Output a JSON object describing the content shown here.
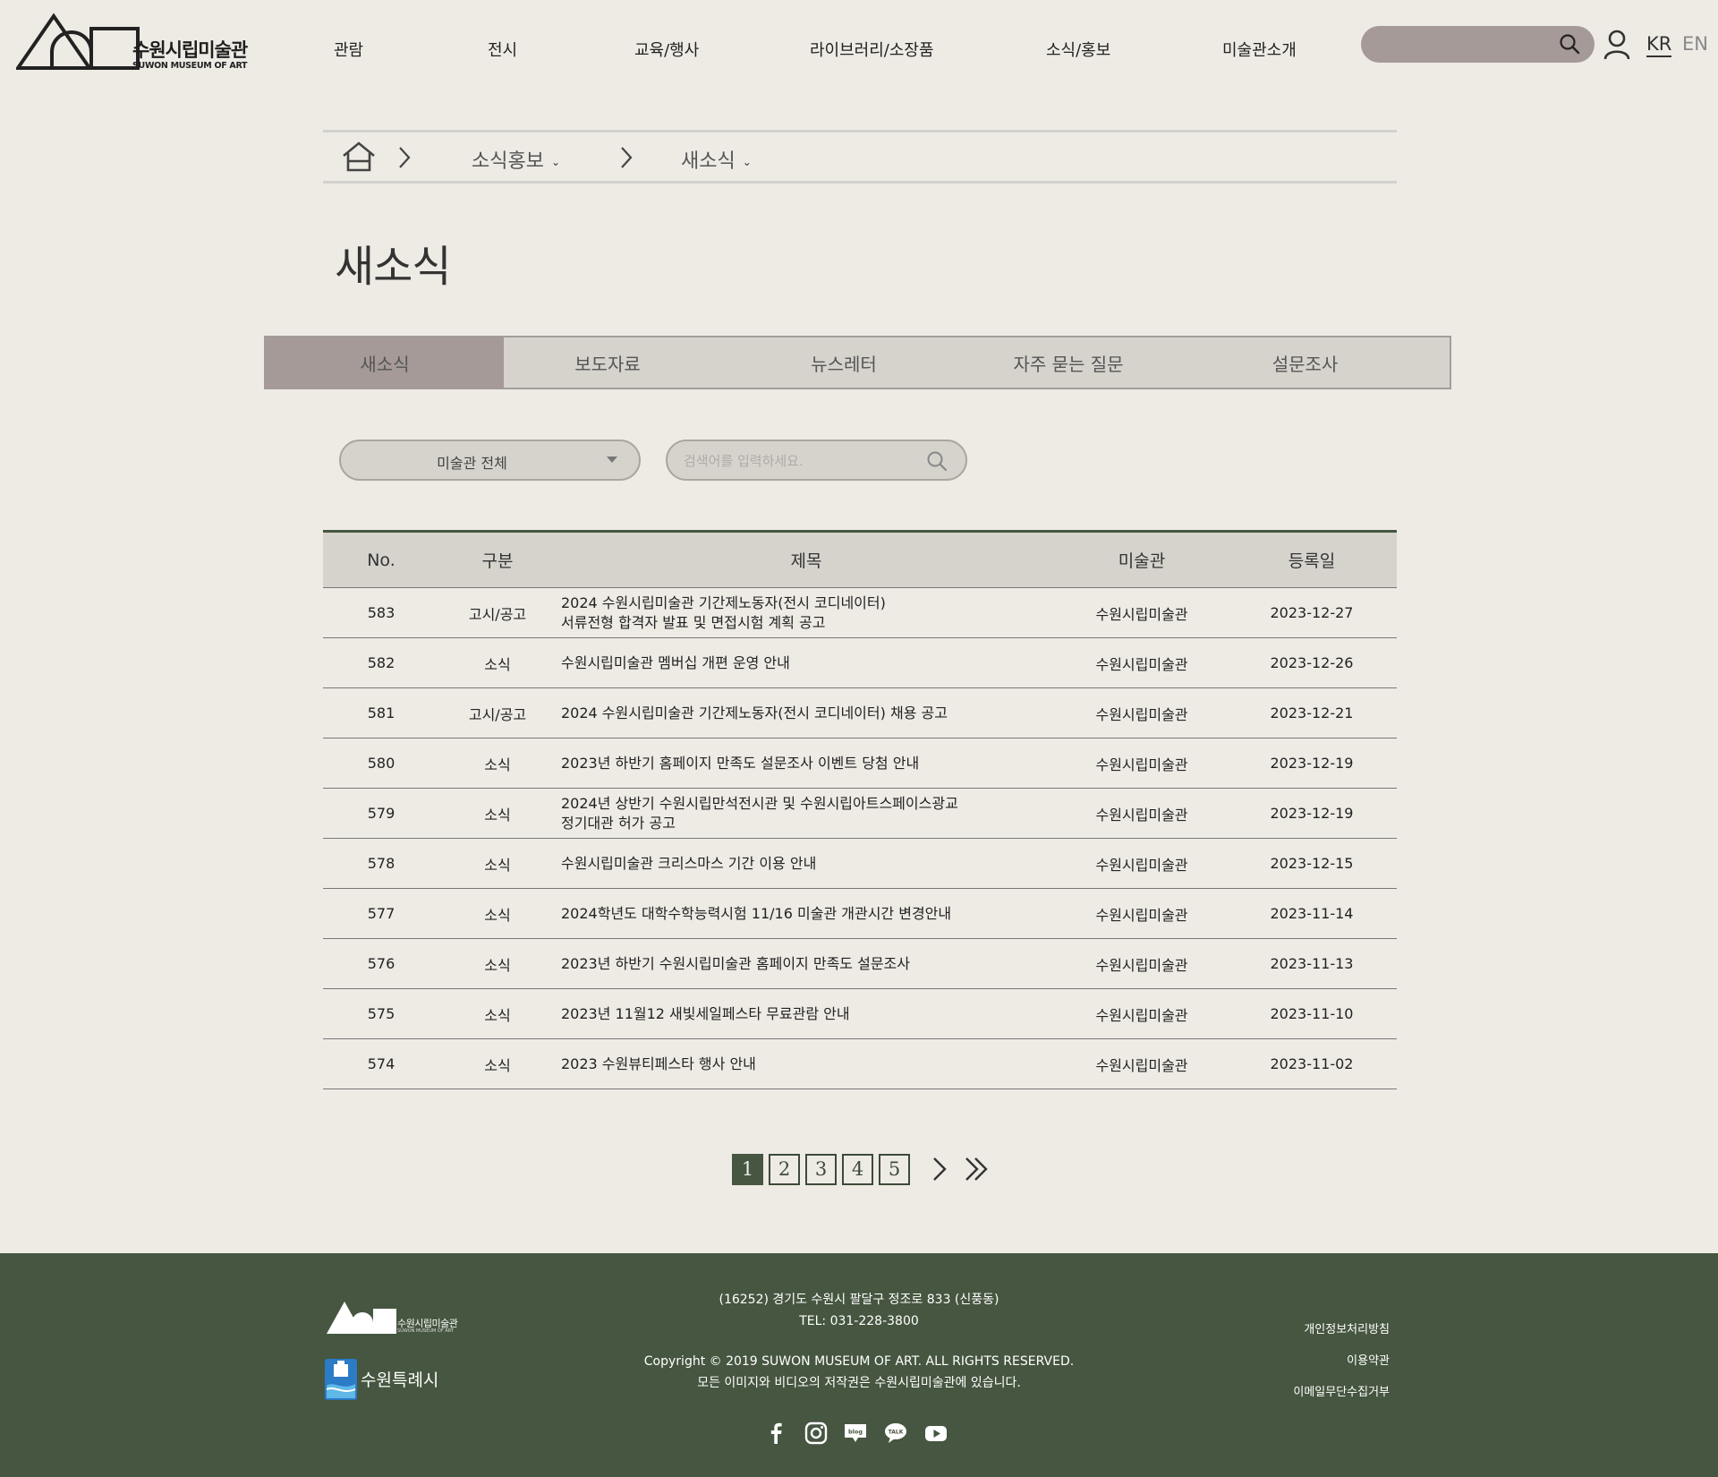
{
  "header": {
    "logo_text": "수원시립미술관",
    "logo_sub": "SUWON MUSEUM OF ART",
    "nav": [
      "관람",
      "전시",
      "교육/행사",
      "라이브러리/소장품",
      "소식/홍보",
      "미술관소개"
    ],
    "lang_kr": "KR",
    "lang_en": "EN"
  },
  "breadcrumb": {
    "section": "소식홍보",
    "page": "새소식"
  },
  "page_title": "새소식",
  "tabs": [
    {
      "label": "새소식",
      "active": true
    },
    {
      "label": "보도자료",
      "active": false
    },
    {
      "label": "뉴스레터",
      "active": false
    },
    {
      "label": "자주 묻는 질문",
      "active": false
    },
    {
      "label": "설문조사",
      "active": false
    }
  ],
  "filter": {
    "select_value": "미술관 전체",
    "search_placeholder": "검색어를 입력하세요."
  },
  "table": {
    "headers": [
      "No.",
      "구분",
      "제목",
      "미술관",
      "등록일"
    ],
    "rows": [
      {
        "no": "583",
        "category": "고시/공고",
        "title": "2024 수원시립미술관 기간제노동자(전시 코디네이터)\n서류전형 합격자 발표 및 면접시험 계획 공고",
        "museum": "수원시립미술관",
        "date": "2023-12-27"
      },
      {
        "no": "582",
        "category": "소식",
        "title": "수원시립미술관 멤버십 개편 운영 안내",
        "museum": "수원시립미술관",
        "date": "2023-12-26"
      },
      {
        "no": "581",
        "category": "고시/공고",
        "title": "2024 수원시립미술관 기간제노동자(전시 코디네이터) 채용 공고",
        "museum": "수원시립미술관",
        "date": "2023-12-21"
      },
      {
        "no": "580",
        "category": "소식",
        "title": "2023년 하반기 홈페이지 만족도 설문조사 이벤트 당첨 안내",
        "museum": "수원시립미술관",
        "date": "2023-12-19"
      },
      {
        "no": "579",
        "category": "소식",
        "title": "2024년 상반기 수원시립만석전시관 및 수원시립아트스페이스광교\n정기대관 허가 공고",
        "museum": "수원시립미술관",
        "date": "2023-12-19"
      },
      {
        "no": "578",
        "category": "소식",
        "title": "수원시립미술관 크리스마스 기간 이용 안내",
        "museum": "수원시립미술관",
        "date": "2023-12-15"
      },
      {
        "no": "577",
        "category": "소식",
        "title": "2024학년도 대학수학능력시험 11/16 미술관 개관시간 변경안내",
        "museum": "수원시립미술관",
        "date": "2023-11-14"
      },
      {
        "no": "576",
        "category": "소식",
        "title": "2023년 하반기 수원시립미술관 홈페이지 만족도 설문조사",
        "museum": "수원시립미술관",
        "date": "2023-11-13"
      },
      {
        "no": "575",
        "category": "소식",
        "title": "2023년 11월12 새빛세일페스타 무료관람 안내",
        "museum": "수원시립미술관",
        "date": "2023-11-10"
      },
      {
        "no": "574",
        "category": "소식",
        "title": "2023 수원뷰티페스타 행사 안내",
        "museum": "수원시립미술관",
        "date": "2023-11-02"
      }
    ]
  },
  "pagination": {
    "pages": [
      "1",
      "2",
      "3",
      "4",
      "5"
    ],
    "current": "1"
  },
  "footer": {
    "logo_text": "수원시립미술관",
    "logo_sub": "SUWON MUSEUM OF ART",
    "city_text": "수원특례시",
    "address": "(16252) 경기도 수원시 팔달구 정조로 833 (신풍동)",
    "tel": "TEL: 031-228-3800",
    "copyright": "Copyright © 2019 SUWON MUSEUM OF ART. ALL RIGHTS RESERVED.",
    "rights": "모든 이미지와 비디오의 저작권은 수원시립미술관에 있습니다.",
    "links": [
      "개인정보처리방침",
      "이용약관",
      "이메일무단수집거부"
    ],
    "social_icons": [
      "facebook-icon",
      "instagram-icon",
      "blog-icon",
      "kakaotalk-icon",
      "youtube-icon"
    ]
  },
  "colors": {
    "background": "#eeebe5",
    "accent_mauve": "#a59a97",
    "footer_green": "#465640",
    "panel_gray": "#d6d3cd"
  }
}
